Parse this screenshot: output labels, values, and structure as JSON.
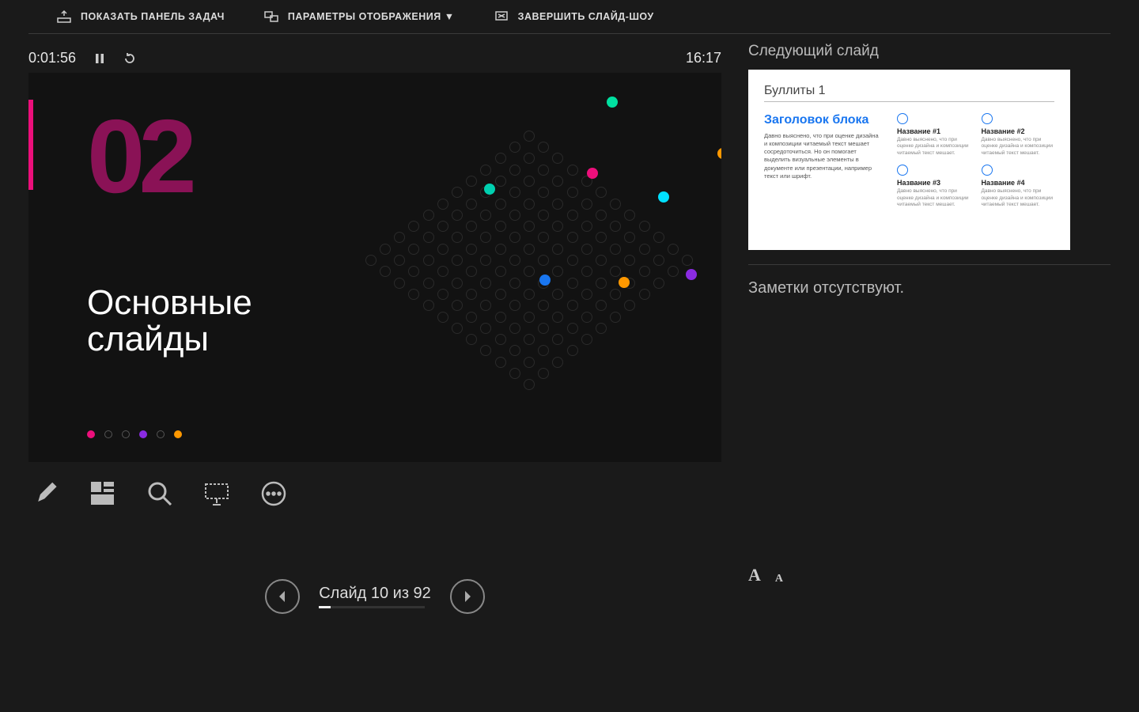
{
  "topbar": {
    "show_taskbar": "ПОКАЗАТЬ ПАНЕЛЬ ЗАДАЧ",
    "display_params": "ПАРАМЕТРЫ ОТОБРАЖЕНИЯ ▼",
    "end_slideshow": "ЗАВЕРШИТЬ СЛАЙД-ШОУ"
  },
  "timer": {
    "elapsed": "0:01:56",
    "clock": "16:17"
  },
  "slide": {
    "number": "02",
    "title_l1": "Основные",
    "title_l2": "слайды"
  },
  "nav": {
    "label": "Слайд 10 из 92",
    "current": 10,
    "total": 92
  },
  "next_slide": {
    "label": "Следующий слайд",
    "thumb_title": "Буллиты 1",
    "block_title": "Заголовок блока",
    "block_text": "Давно выяснено, что при оценке дизайна и композиции читаемый текст мешает сосредоточиться. Но он помогает выделить визуальные элементы в документе или презентации, например текст или шрифт.",
    "cells": [
      {
        "title": "Название #1",
        "text": "Давно выяснено, что при оценке дизайна и композиции читаемый текст мешает."
      },
      {
        "title": "Название #2",
        "text": "Давно выяснено, что при оценке дизайна и композиции читаемый текст мешает."
      },
      {
        "title": "Название #3",
        "text": "Давно выяснено, что при оценке дизайна и композиции читаемый текст мешает."
      },
      {
        "title": "Название #4",
        "text": "Давно выяснено, что при оценке дизайна и композиции читаемый текст мешает."
      }
    ]
  },
  "notes": {
    "empty_text": "Заметки отсутствуют."
  },
  "font_controls": {
    "large": "A",
    "small": "A"
  }
}
